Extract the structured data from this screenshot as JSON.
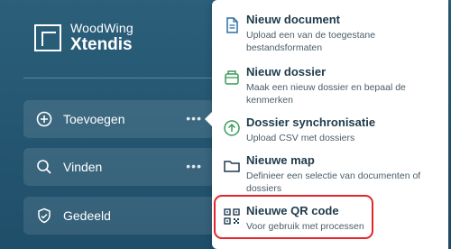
{
  "app": {
    "logo": {
      "line1": "WoodWing",
      "line2": "Xtendis"
    }
  },
  "sidebar": {
    "items": [
      {
        "label": "Toevoegen",
        "icon": "plus-circle-icon",
        "more": "•••"
      },
      {
        "label": "Vinden",
        "icon": "search-icon",
        "more": "•••"
      },
      {
        "label": "Gedeeld",
        "icon": "shared-shield-icon"
      }
    ]
  },
  "menu": {
    "items": [
      {
        "title": "Nieuw document",
        "desc": "Upload een van de toegestane bestandsformaten",
        "icon": "document-icon",
        "icon_color": "#2b6ea3"
      },
      {
        "title": "Nieuw dossier",
        "desc": "Maak een nieuw dossier en bepaal de kenmerken",
        "icon": "dossier-icon",
        "icon_color": "#3a9a5b"
      },
      {
        "title": "Dossier synchronisatie",
        "desc": "Upload CSV met dossiers",
        "icon": "upload-circle-icon",
        "icon_color": "#3a9a5b"
      },
      {
        "title": "Nieuwe map",
        "desc": "Definieer een selectie van documenten of dossiers",
        "icon": "folder-icon",
        "icon_color": "#1e3a4b"
      },
      {
        "title": "Nieuwe QR code",
        "desc": "Voor gebruik met processen",
        "icon": "qr-code-icon",
        "icon_color": "#1e3a4b"
      }
    ]
  },
  "colors": {
    "sidebar_bg": "#22536f",
    "highlight": "#e3262c"
  }
}
